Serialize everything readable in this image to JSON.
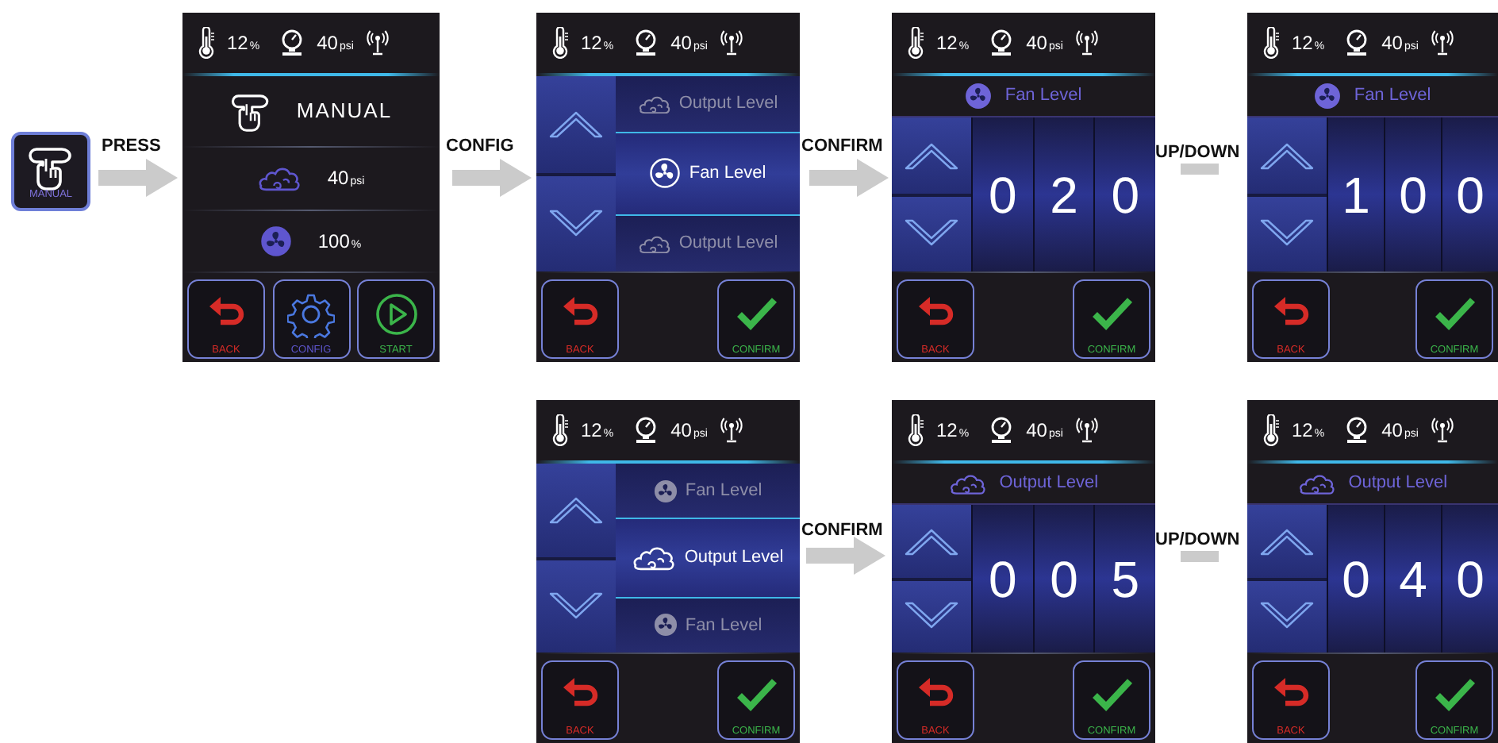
{
  "start_button": {
    "label": "MANUAL"
  },
  "transitions": [
    {
      "kind": "arrow",
      "label": "PRESS"
    },
    {
      "kind": "arrow",
      "label": "CONFIG"
    },
    {
      "kind": "arrow",
      "label": "CONFIRM"
    },
    {
      "kind": "bar",
      "label": "UP/DOWN"
    },
    {
      "kind": "arrow",
      "label": "CONFIRM"
    },
    {
      "kind": "bar",
      "label": "UP/DOWN"
    }
  ],
  "screens": [
    {
      "kind": "overview",
      "status": {
        "temperature": "12",
        "temperature_unit": "%",
        "pressure": "40",
        "pressure_unit": "psi"
      },
      "title": "MANUAL",
      "readings": [
        {
          "kind": "output",
          "value": "40",
          "unit": "psi"
        },
        {
          "kind": "fan",
          "value": "100",
          "unit": "%"
        }
      ],
      "buttons": [
        {
          "kind": "back",
          "label": "BACK"
        },
        {
          "kind": "config",
          "label": "CONFIG"
        },
        {
          "kind": "start",
          "label": "START"
        }
      ]
    },
    {
      "kind": "menu",
      "status": {
        "temperature": "12",
        "temperature_unit": "%",
        "pressure": "40",
        "pressure_unit": "psi"
      },
      "items": [
        {
          "kind": "output",
          "label": "Output Level",
          "selected": false
        },
        {
          "kind": "fan",
          "label": "Fan Level",
          "selected": true
        },
        {
          "kind": "output",
          "label": "Output Level",
          "selected": false
        }
      ],
      "buttons": [
        {
          "kind": "back",
          "label": "BACK"
        },
        {
          "kind": "confirm",
          "label": "CONFIRM"
        }
      ]
    },
    {
      "kind": "edit",
      "status": {
        "temperature": "12",
        "temperature_unit": "%",
        "pressure": "40",
        "pressure_unit": "psi"
      },
      "heading": {
        "kind": "fan",
        "label": "Fan Level"
      },
      "digits": [
        "0",
        "2",
        "0"
      ],
      "buttons": [
        {
          "kind": "back",
          "label": "BACK"
        },
        {
          "kind": "confirm",
          "label": "CONFIRM"
        }
      ]
    },
    {
      "kind": "edit",
      "status": {
        "temperature": "12",
        "temperature_unit": "%",
        "pressure": "40",
        "pressure_unit": "psi"
      },
      "heading": {
        "kind": "fan",
        "label": "Fan Level"
      },
      "digits": [
        "1",
        "0",
        "0"
      ],
      "buttons": [
        {
          "kind": "back",
          "label": "BACK"
        },
        {
          "kind": "confirm",
          "label": "CONFIRM"
        }
      ]
    },
    {
      "kind": "menu",
      "status": {
        "temperature": "12",
        "temperature_unit": "%",
        "pressure": "40",
        "pressure_unit": "psi"
      },
      "items": [
        {
          "kind": "fan",
          "label": "Fan Level",
          "selected": false
        },
        {
          "kind": "output",
          "label": "Output Level",
          "selected": true
        },
        {
          "kind": "fan",
          "label": "Fan Level",
          "selected": false
        }
      ],
      "buttons": [
        {
          "kind": "back",
          "label": "BACK"
        },
        {
          "kind": "confirm",
          "label": "CONFIRM"
        }
      ]
    },
    {
      "kind": "edit",
      "status": {
        "temperature": "12",
        "temperature_unit": "%",
        "pressure": "40",
        "pressure_unit": "psi"
      },
      "heading": {
        "kind": "output",
        "label": "Output Level"
      },
      "digits": [
        "0",
        "0",
        "5"
      ],
      "buttons": [
        {
          "kind": "back",
          "label": "BACK"
        },
        {
          "kind": "confirm",
          "label": "CONFIRM"
        }
      ]
    },
    {
      "kind": "edit",
      "status": {
        "temperature": "12",
        "temperature_unit": "%",
        "pressure": "40",
        "pressure_unit": "psi"
      },
      "heading": {
        "kind": "output",
        "label": "Output Level"
      },
      "digits": [
        "0",
        "4",
        "0"
      ],
      "buttons": [
        {
          "kind": "back",
          "label": "BACK"
        },
        {
          "kind": "confirm",
          "label": "CONFIRM"
        }
      ]
    }
  ]
}
